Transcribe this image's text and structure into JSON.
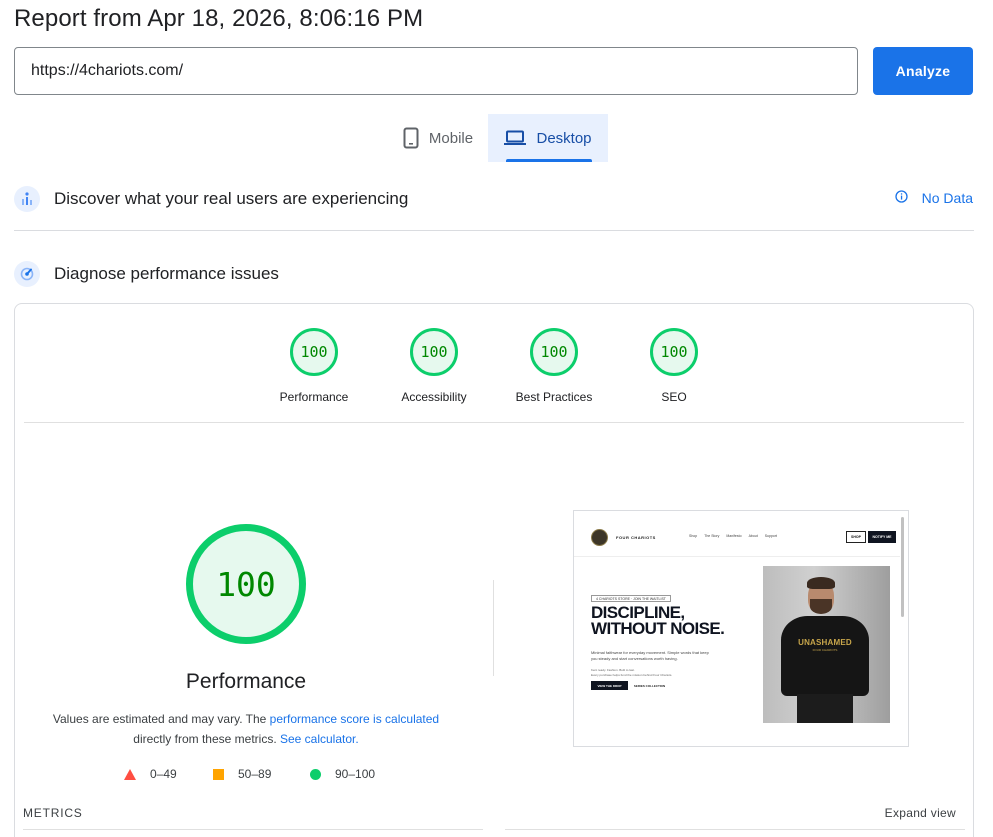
{
  "report": {
    "title": "Report from Apr 18, 2026, 8:06:16 PM"
  },
  "search": {
    "url": "https://4chariots.com/",
    "analyze_label": "Analyze"
  },
  "tabs": [
    {
      "label": "Mobile",
      "icon": "phone-icon",
      "selected": false
    },
    {
      "label": "Desktop",
      "icon": "laptop-icon",
      "selected": true
    }
  ],
  "crux": {
    "heading": "Discover what your real users are experiencing",
    "status": "No Data"
  },
  "diagnose": {
    "heading": "Diagnose performance issues"
  },
  "categories": [
    {
      "label": "Performance",
      "score": "100"
    },
    {
      "label": "Accessibility",
      "score": "100"
    },
    {
      "label": "Best Practices",
      "score": "100"
    },
    {
      "label": "SEO",
      "score": "100"
    }
  ],
  "performance": {
    "score": "100",
    "label": "Performance",
    "note_prefix": "Values are estimated and may vary. The ",
    "note_link1": "performance score is calculated",
    "note_middle": " directly from these metrics. ",
    "note_link2": "See calculator."
  },
  "legend": [
    {
      "range": "0–49",
      "color": "#ff4e42"
    },
    {
      "range": "50–89",
      "color": "#ffa400"
    },
    {
      "range": "90–100",
      "color": "#0cce6b"
    }
  ],
  "screenshot": {
    "brand": "FOUR CHARIOTS",
    "nav_links": [
      "Shop",
      "The Story",
      "Manifesto",
      "About",
      "Support"
    ],
    "btn_shop": "SHOP",
    "btn_notify": "NOTIFY ME",
    "tag": "4 CHARIOTS STORE · JOIN THE WAITLIST",
    "headline_1": "DISCIPLINE,",
    "headline_2": "WITHOUT NOISE.",
    "paragraph": "Minimal faithwear for everyday movement. Simple words that keep you steady and start conversations worth having.",
    "small": "Kent ready. Fashion. Built to last.",
    "small_2": "Every purchase helps fund the mission behind Four Chariots.",
    "cta_primary": "VIEW THE DROP",
    "cta_secondary": "SERIES COLLECTION",
    "shirt_text": "UNASHAMED",
    "shirt_sub": "FOUR CHARIOTS"
  },
  "metrics": {
    "label": "METRICS",
    "expand": "Expand view"
  },
  "colors": {
    "accent": "#1a73e8",
    "pass": "#0cce6b",
    "pass_text": "#008800",
    "average": "#ffa400",
    "fail": "#ff4e42"
  }
}
